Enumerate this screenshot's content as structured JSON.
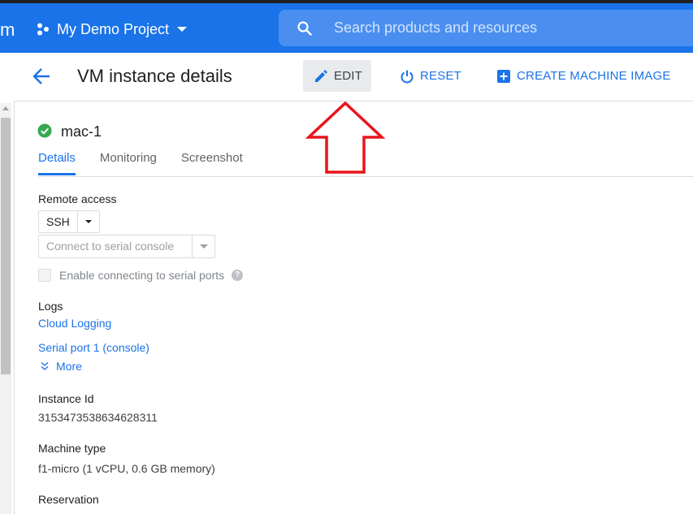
{
  "topbar": {
    "brand_fragment": "m",
    "project_name": "My Demo Project",
    "search_placeholder": "Search products and resources"
  },
  "header": {
    "title": "VM instance details",
    "edit_label": "EDIT",
    "reset_label": "RESET",
    "create_image_label": "CREATE MACHINE IMAGE"
  },
  "instance": {
    "name": "mac-1",
    "status_icon": "check-circle-icon",
    "status_color": "#34a853"
  },
  "tabs": [
    "Details",
    "Monitoring",
    "Screenshot"
  ],
  "remote_access": {
    "label": "Remote access",
    "ssh_label": "SSH",
    "serial_console_label": "Connect to serial console",
    "enable_serial_label": "Enable connecting to serial ports"
  },
  "logs": {
    "label": "Logs",
    "cloud_logging": "Cloud Logging",
    "serial_port": "Serial port 1 (console)",
    "more": "More"
  },
  "details": {
    "instance_id_label": "Instance Id",
    "instance_id": "3153473538634628311",
    "machine_type_label": "Machine type",
    "machine_type": "f1-micro (1 vCPU, 0.6 GB memory)",
    "reservation_label": "Reservation"
  },
  "colors": {
    "accent": "#1a73e8",
    "annotation_arrow": "#e8141b"
  }
}
